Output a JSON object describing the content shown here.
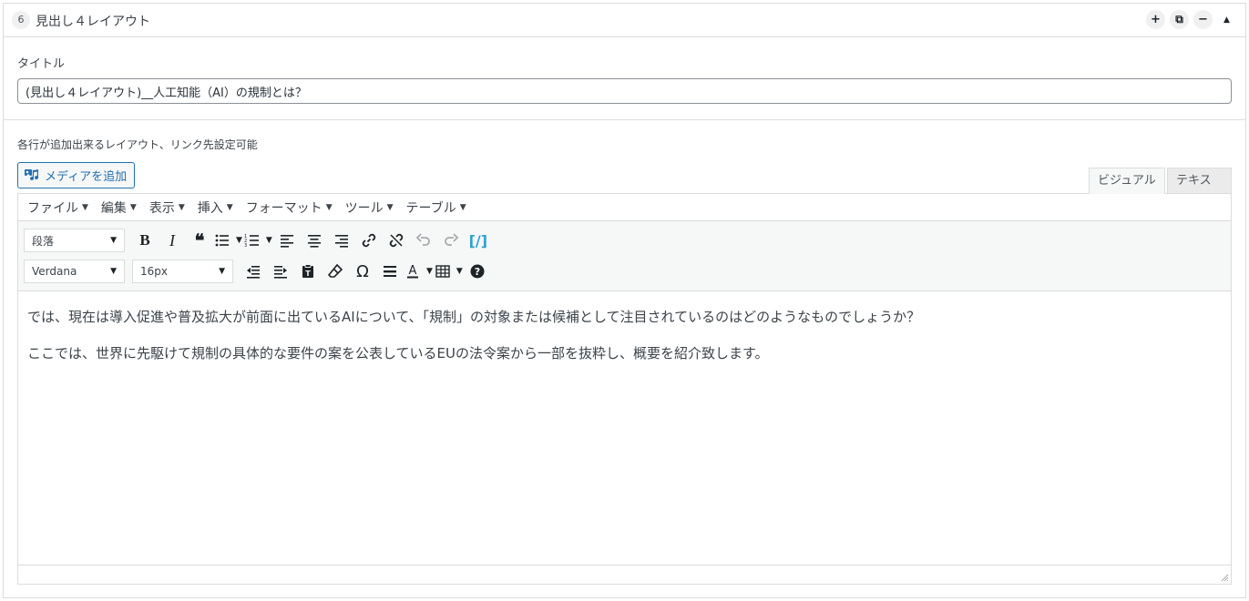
{
  "header": {
    "row_number": "6",
    "title": "見出し４レイアウト",
    "controls": [
      {
        "name": "add-row-button",
        "icon": "plus-icon",
        "glyph": "+"
      },
      {
        "name": "duplicate-row-button",
        "icon": "duplicate-icon",
        "glyph": "⧉"
      },
      {
        "name": "remove-row-button",
        "icon": "minus-icon",
        "glyph": "−"
      },
      {
        "name": "collapse-row-button",
        "icon": "triangle-up-icon",
        "glyph": "▲"
      }
    ]
  },
  "title_field": {
    "label": "タイトル",
    "value": "(見出し４レイアウト)__人工知能（AI）の規制とは？"
  },
  "editor": {
    "description": "各行が追加出来るレイアウト、リンク先設定可能",
    "media_button": "メディアを追加",
    "tabs": {
      "visual": "ビジュアル",
      "text": "テキスト"
    },
    "menu": [
      "ファイル",
      "編集",
      "表示",
      "挿入",
      "フォーマット",
      "ツール",
      "テーブル"
    ],
    "format_select": "段落",
    "font_select": "Verdana",
    "size_select": "16px",
    "content": [
      "では、現在は導入促進や普及拡大が前面に出ているAIについて、「規制」の対象または候補として注目されているのはどのようなものでしょうか？",
      "ここでは、世界に先駆けて規制の具体的な要件の案を公表しているEUの法令案から一部を抜粋し、概要を紹介致します。"
    ]
  }
}
